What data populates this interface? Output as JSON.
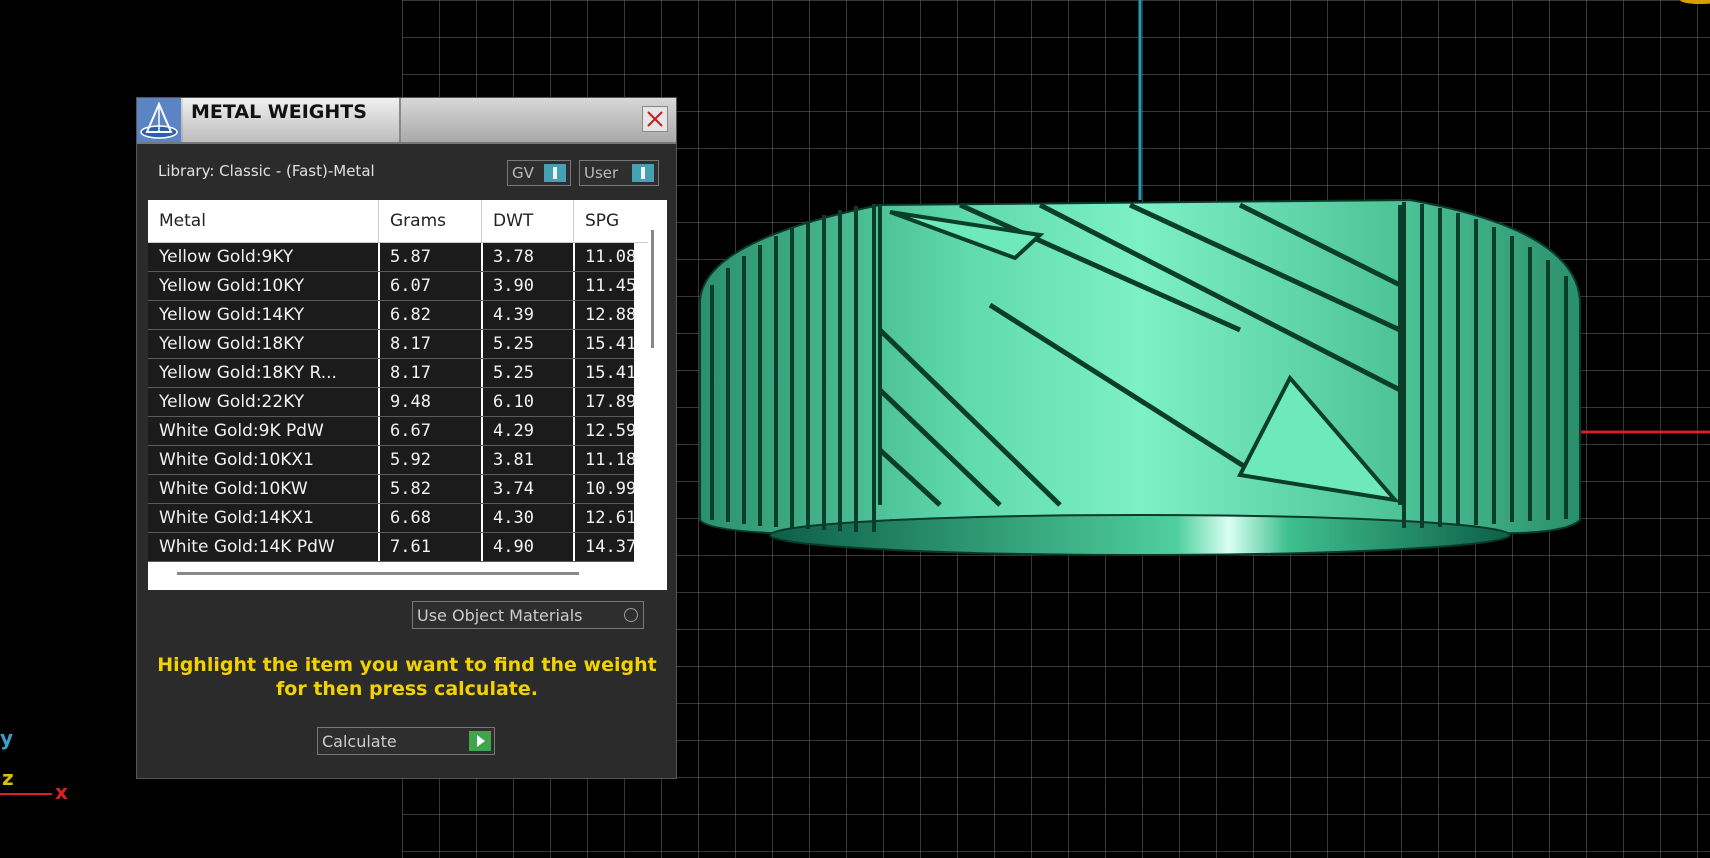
{
  "panel": {
    "title": "METAL WEIGHTS",
    "library_label": "Library: Classic - (Fast)-Metal",
    "toggles": [
      {
        "label": "GV",
        "state": "on"
      },
      {
        "label": "User",
        "state": "on"
      }
    ],
    "table": {
      "columns": [
        "Metal",
        "Grams",
        "DWT",
        "SPG"
      ],
      "rows": [
        [
          "Yellow Gold:9KY",
          "5.87",
          "3.78",
          "11.08"
        ],
        [
          "Yellow Gold:10KY",
          "6.07",
          "3.90",
          "11.45"
        ],
        [
          "Yellow Gold:14KY",
          "6.82",
          "4.39",
          "12.88"
        ],
        [
          "Yellow Gold:18KY",
          "8.17",
          "5.25",
          "15.41"
        ],
        [
          "Yellow Gold:18KY R...",
          "8.17",
          "5.25",
          "15.41"
        ],
        [
          "Yellow Gold:22KY",
          "9.48",
          "6.10",
          "17.89"
        ],
        [
          "White Gold:9K PdW",
          "6.67",
          "4.29",
          "12.59"
        ],
        [
          "White Gold:10KX1",
          "5.92",
          "3.81",
          "11.18"
        ],
        [
          "White Gold:10KW",
          "5.82",
          "3.74",
          "10.99"
        ],
        [
          "White Gold:14KX1",
          "6.68",
          "4.30",
          "12.61"
        ],
        [
          "White Gold:14K PdW",
          "7.61",
          "4.90",
          "14.37"
        ]
      ]
    },
    "use_object_materials_label": "Use Object Materials",
    "hint_line1": "Highlight the item you want to find the weight",
    "hint_line2": "for then press calculate.",
    "calculate_label": "Calculate"
  },
  "axes": {
    "y": "y",
    "z": "z",
    "x": "x"
  },
  "colors": {
    "ring": "#58d6a6",
    "grid": "#6e6e6e",
    "hint": "#f2d200",
    "accent": "#46a0b4",
    "go": "#3ea64a"
  }
}
